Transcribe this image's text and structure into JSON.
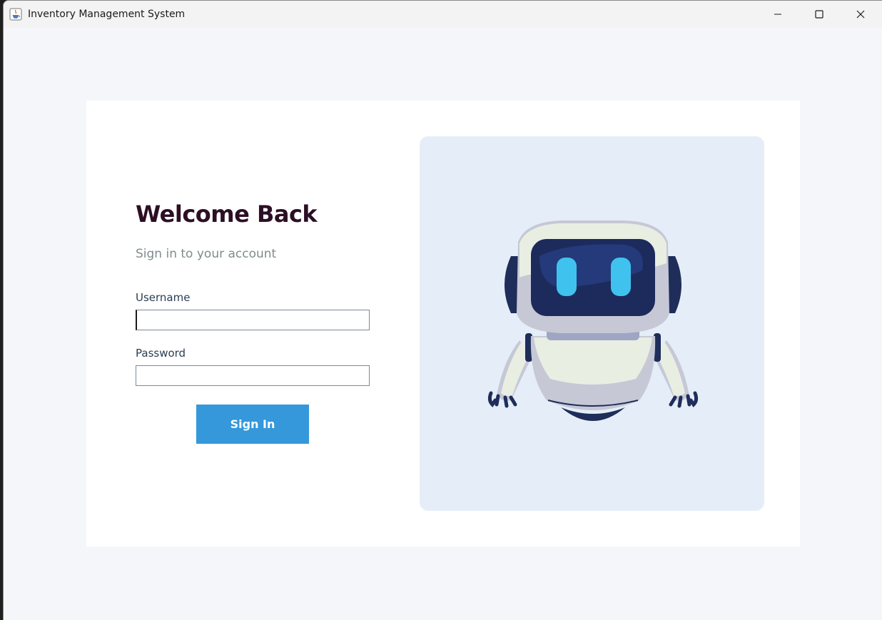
{
  "window": {
    "title": "Inventory Management System"
  },
  "login": {
    "heading": "Welcome Back",
    "subtitle": "Sign in to your account",
    "username_label": "Username",
    "username_value": "",
    "password_label": "Password",
    "password_value": "",
    "signin_label": "Sign In"
  },
  "icons": {
    "app": "java-coffee-cup-icon",
    "minimize": "minimize-icon",
    "maximize": "maximize-icon",
    "close": "close-icon",
    "illustration": "robot-illustration"
  },
  "colors": {
    "accent": "#3498db",
    "heading": "#2c0f25",
    "illustration_bg": "#e5eef8",
    "page_bg": "#f5f6fa"
  }
}
